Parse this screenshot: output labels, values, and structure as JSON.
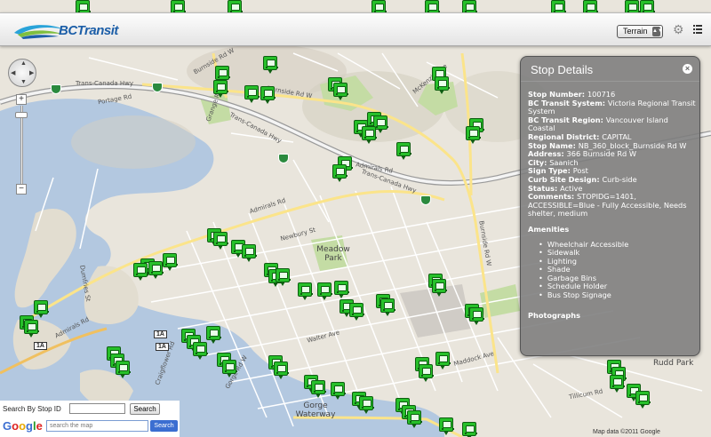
{
  "header": {
    "logo_text": "BCTransit",
    "map_type": "Terrain",
    "icons": [
      "settings-gear-icon",
      "legend-list-icon"
    ]
  },
  "map": {
    "labels": {
      "trans_canada_1": "Trans-Canada Hwy",
      "trans_canada_2": "Trans-Canada Hwy",
      "trans_canada_3": "Trans-Canada Hwy",
      "burnside_1": "Burnside Rd W",
      "burnside_2": "Burnside Rd W",
      "burnside_3": "Burnside Rd W",
      "admirals_1": "Admirals Rd",
      "admirals_2": "Admirals Rd",
      "admirals_3": "Admirals Rd",
      "mckenzie": "McKenzie Ave",
      "portage": "Portage Rd",
      "grange": "Grange Rd",
      "tillicum": "Tillicum Rd",
      "craigflower": "Craigflower Rd",
      "gorge_rd": "Gorge Rd W",
      "meadow_park": "Meadow Park",
      "gorge_waterway": "Gorge Waterway",
      "rudd_park": "Rudd Park",
      "newbury": "Newbury St",
      "walter": "Walter Ave",
      "maddock": "Maddock Ave",
      "dumfries": "Dumfries St",
      "highway_1a_a": "1A",
      "highway_1a_b": "1A",
      "highway_1a_c": "1A"
    },
    "credits": "Map data ©2011 Google"
  },
  "colors": {
    "water": "#b3c8e0",
    "land": "#e9e5dc",
    "bus_marker": "#27c02a",
    "panel_bg": "#7c7c7c",
    "logo_blue": "#1d5fa8"
  },
  "panel": {
    "title": "Stop Details",
    "rows": [
      {
        "label": "Stop Number:",
        "value": "100716"
      },
      {
        "label": "BC Transit System:",
        "value": "Victoria Regional Transit System"
      },
      {
        "label": "BC Transit Region:",
        "value": "Vancouver Island Coastal"
      },
      {
        "label": "Regional District:",
        "value": "CAPITAL"
      },
      {
        "label": "Stop Name:",
        "value": "NB_360_block_Burnside Rd W"
      },
      {
        "label": "Address:",
        "value": "366 Burnside Rd W"
      },
      {
        "label": "City:",
        "value": "Saanich"
      },
      {
        "label": "Sign Type:",
        "value": "Post"
      },
      {
        "label": "Curb Site Design:",
        "value": "Curb-side"
      },
      {
        "label": "Status:",
        "value": "Active"
      },
      {
        "label": "Comments:",
        "value": "STOPIDG=1401, ACCESSIBLE=Blue - Fully Accessible, Needs shelter, medium"
      }
    ],
    "amenities_heading": "Amenities",
    "amenities": [
      "Wheelchair Accessible",
      "Sidewalk",
      "Lighting",
      "Shade",
      "Garbage Bins",
      "Schedule Holder",
      "Bus Stop Signage"
    ],
    "photographs_heading": "Photographs"
  },
  "search": {
    "stop_label": "Search By Stop ID",
    "stop_value": "",
    "stop_button": "Search",
    "google_logo": "Google",
    "map_placeholder": "search the map",
    "map_button": "Search"
  }
}
